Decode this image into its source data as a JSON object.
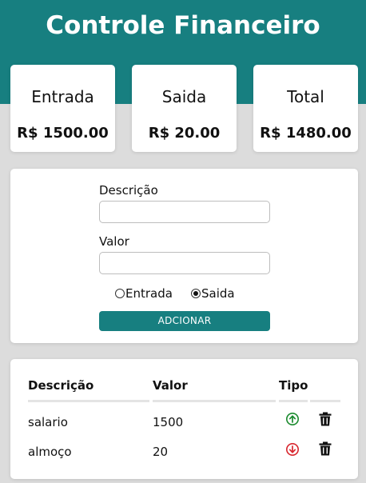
{
  "app": {
    "title": "Controle Financeiro"
  },
  "summary": {
    "entrada": {
      "label": "Entrada",
      "value": "R$ 1500.00"
    },
    "saida": {
      "label": "Saida",
      "value": "R$ 20.00"
    },
    "total": {
      "label": "Total",
      "value": "R$ 1480.00"
    }
  },
  "form": {
    "descricao_label": "Descrição",
    "descricao_value": "",
    "valor_label": "Valor",
    "valor_value": "",
    "radio_entrada": "Entrada",
    "radio_saida": "Saida",
    "selected_type": "Saida",
    "add_button": "ADCIONAR"
  },
  "table": {
    "headers": [
      "Descrição",
      "Valor",
      "Tipo"
    ],
    "rows": [
      {
        "descricao": "salario",
        "valor": "1500",
        "tipo": "entrada"
      },
      {
        "descricao": "almoço",
        "valor": "20",
        "tipo": "saida"
      }
    ]
  },
  "colors": {
    "brand": "#177f80",
    "entrada_icon": "#1a8a2e",
    "saida_icon": "#d8262e"
  },
  "icons": {
    "entrada": "arrow-up-circle-icon",
    "saida": "arrow-down-circle-icon",
    "delete": "trash-icon"
  }
}
